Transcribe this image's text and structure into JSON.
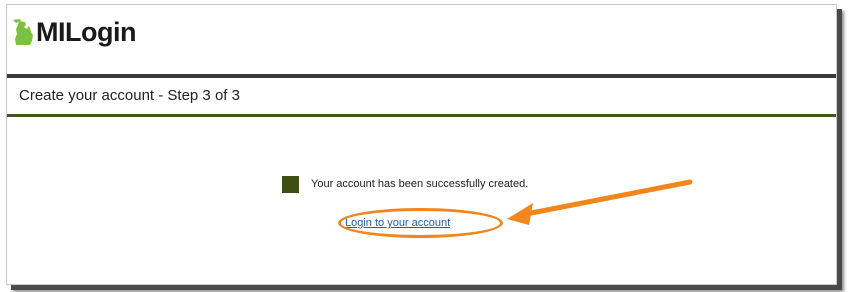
{
  "brand": {
    "name": "MILogin",
    "logo_icon": "michigan-state-icon",
    "accent_color": "#3e5a1e"
  },
  "page": {
    "step_title": "Create your account - Step 3 of 3"
  },
  "status": {
    "message": "Your account has been successfully created.",
    "square_color": "#3d4f12"
  },
  "actions": {
    "login_link": "Login to your account"
  },
  "annotation": {
    "color": "#f0861c"
  }
}
